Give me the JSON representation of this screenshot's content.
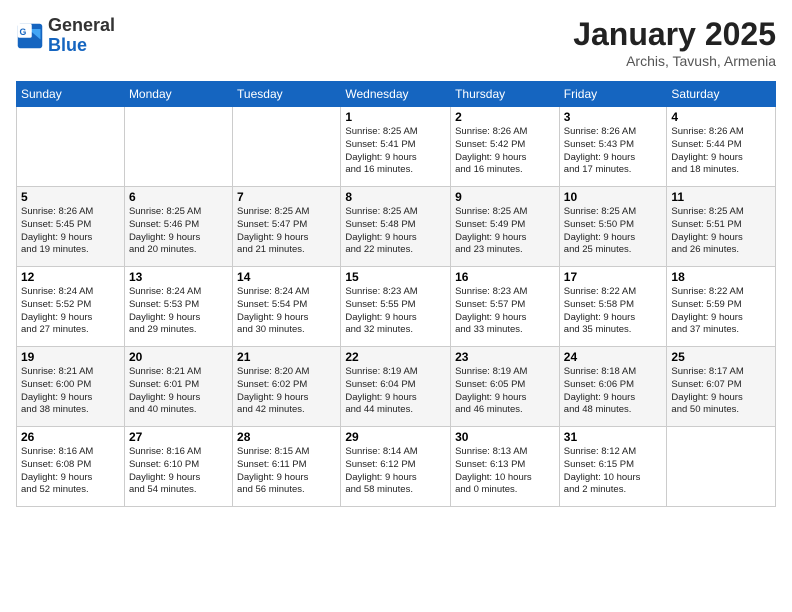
{
  "header": {
    "logo_general": "General",
    "logo_blue": "Blue",
    "title": "January 2025",
    "subtitle": "Archis, Tavush, Armenia"
  },
  "days_of_week": [
    "Sunday",
    "Monday",
    "Tuesday",
    "Wednesday",
    "Thursday",
    "Friday",
    "Saturday"
  ],
  "weeks": [
    [
      {
        "day": "",
        "info": ""
      },
      {
        "day": "",
        "info": ""
      },
      {
        "day": "",
        "info": ""
      },
      {
        "day": "1",
        "info": "Sunrise: 8:25 AM\nSunset: 5:41 PM\nDaylight: 9 hours\nand 16 minutes."
      },
      {
        "day": "2",
        "info": "Sunrise: 8:26 AM\nSunset: 5:42 PM\nDaylight: 9 hours\nand 16 minutes."
      },
      {
        "day": "3",
        "info": "Sunrise: 8:26 AM\nSunset: 5:43 PM\nDaylight: 9 hours\nand 17 minutes."
      },
      {
        "day": "4",
        "info": "Sunrise: 8:26 AM\nSunset: 5:44 PM\nDaylight: 9 hours\nand 18 minutes."
      }
    ],
    [
      {
        "day": "5",
        "info": "Sunrise: 8:26 AM\nSunset: 5:45 PM\nDaylight: 9 hours\nand 19 minutes."
      },
      {
        "day": "6",
        "info": "Sunrise: 8:25 AM\nSunset: 5:46 PM\nDaylight: 9 hours\nand 20 minutes."
      },
      {
        "day": "7",
        "info": "Sunrise: 8:25 AM\nSunset: 5:47 PM\nDaylight: 9 hours\nand 21 minutes."
      },
      {
        "day": "8",
        "info": "Sunrise: 8:25 AM\nSunset: 5:48 PM\nDaylight: 9 hours\nand 22 minutes."
      },
      {
        "day": "9",
        "info": "Sunrise: 8:25 AM\nSunset: 5:49 PM\nDaylight: 9 hours\nand 23 minutes."
      },
      {
        "day": "10",
        "info": "Sunrise: 8:25 AM\nSunset: 5:50 PM\nDaylight: 9 hours\nand 25 minutes."
      },
      {
        "day": "11",
        "info": "Sunrise: 8:25 AM\nSunset: 5:51 PM\nDaylight: 9 hours\nand 26 minutes."
      }
    ],
    [
      {
        "day": "12",
        "info": "Sunrise: 8:24 AM\nSunset: 5:52 PM\nDaylight: 9 hours\nand 27 minutes."
      },
      {
        "day": "13",
        "info": "Sunrise: 8:24 AM\nSunset: 5:53 PM\nDaylight: 9 hours\nand 29 minutes."
      },
      {
        "day": "14",
        "info": "Sunrise: 8:24 AM\nSunset: 5:54 PM\nDaylight: 9 hours\nand 30 minutes."
      },
      {
        "day": "15",
        "info": "Sunrise: 8:23 AM\nSunset: 5:55 PM\nDaylight: 9 hours\nand 32 minutes."
      },
      {
        "day": "16",
        "info": "Sunrise: 8:23 AM\nSunset: 5:57 PM\nDaylight: 9 hours\nand 33 minutes."
      },
      {
        "day": "17",
        "info": "Sunrise: 8:22 AM\nSunset: 5:58 PM\nDaylight: 9 hours\nand 35 minutes."
      },
      {
        "day": "18",
        "info": "Sunrise: 8:22 AM\nSunset: 5:59 PM\nDaylight: 9 hours\nand 37 minutes."
      }
    ],
    [
      {
        "day": "19",
        "info": "Sunrise: 8:21 AM\nSunset: 6:00 PM\nDaylight: 9 hours\nand 38 minutes."
      },
      {
        "day": "20",
        "info": "Sunrise: 8:21 AM\nSunset: 6:01 PM\nDaylight: 9 hours\nand 40 minutes."
      },
      {
        "day": "21",
        "info": "Sunrise: 8:20 AM\nSunset: 6:02 PM\nDaylight: 9 hours\nand 42 minutes."
      },
      {
        "day": "22",
        "info": "Sunrise: 8:19 AM\nSunset: 6:04 PM\nDaylight: 9 hours\nand 44 minutes."
      },
      {
        "day": "23",
        "info": "Sunrise: 8:19 AM\nSunset: 6:05 PM\nDaylight: 9 hours\nand 46 minutes."
      },
      {
        "day": "24",
        "info": "Sunrise: 8:18 AM\nSunset: 6:06 PM\nDaylight: 9 hours\nand 48 minutes."
      },
      {
        "day": "25",
        "info": "Sunrise: 8:17 AM\nSunset: 6:07 PM\nDaylight: 9 hours\nand 50 minutes."
      }
    ],
    [
      {
        "day": "26",
        "info": "Sunrise: 8:16 AM\nSunset: 6:08 PM\nDaylight: 9 hours\nand 52 minutes."
      },
      {
        "day": "27",
        "info": "Sunrise: 8:16 AM\nSunset: 6:10 PM\nDaylight: 9 hours\nand 54 minutes."
      },
      {
        "day": "28",
        "info": "Sunrise: 8:15 AM\nSunset: 6:11 PM\nDaylight: 9 hours\nand 56 minutes."
      },
      {
        "day": "29",
        "info": "Sunrise: 8:14 AM\nSunset: 6:12 PM\nDaylight: 9 hours\nand 58 minutes."
      },
      {
        "day": "30",
        "info": "Sunrise: 8:13 AM\nSunset: 6:13 PM\nDaylight: 10 hours\nand 0 minutes."
      },
      {
        "day": "31",
        "info": "Sunrise: 8:12 AM\nSunset: 6:15 PM\nDaylight: 10 hours\nand 2 minutes."
      },
      {
        "day": "",
        "info": ""
      }
    ]
  ]
}
